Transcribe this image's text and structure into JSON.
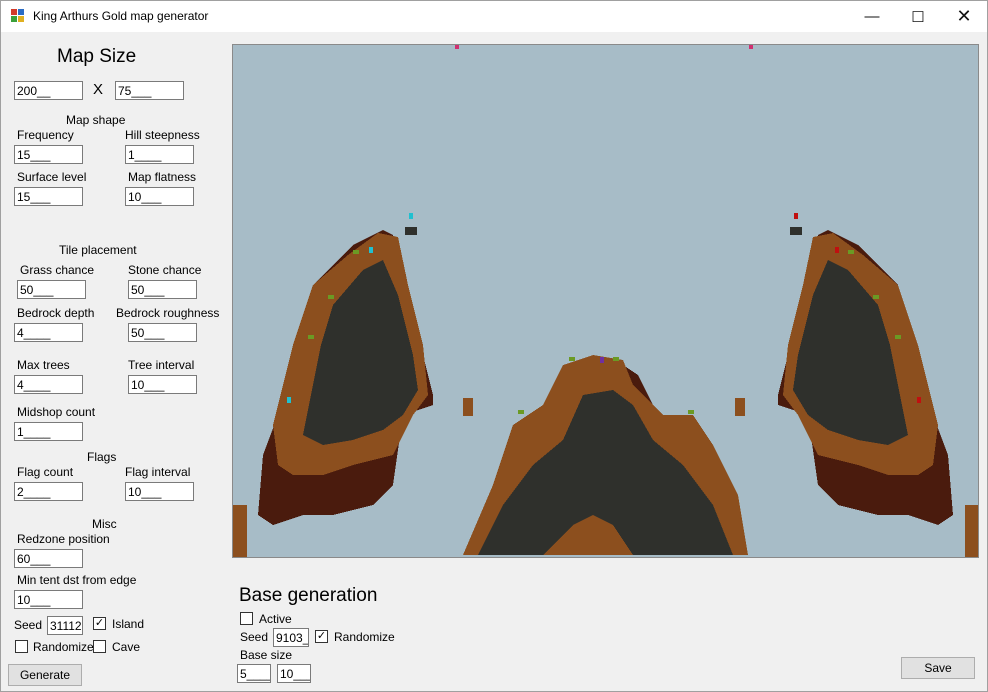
{
  "window": {
    "title": "King Arthurs Gold map generator",
    "minimize_icon": "minimize-icon",
    "maximize_icon": "maximize-icon",
    "close_icon": "close-icon"
  },
  "map_size": {
    "heading": "Map Size",
    "width": "200__",
    "x_label": "X",
    "height": "75___"
  },
  "map_shape": {
    "heading": "Map shape",
    "frequency": {
      "label": "Frequency",
      "value": "15___"
    },
    "hill_steepness": {
      "label": "Hill steepness",
      "value": "1____"
    },
    "surface_level": {
      "label": "Surface level",
      "value": "15___"
    },
    "map_flatness": {
      "label": "Map flatness",
      "value": "10___"
    }
  },
  "tile_placement": {
    "heading": "Tile placement",
    "grass_chance": {
      "label": "Grass chance",
      "value": "50___"
    },
    "stone_chance": {
      "label": "Stone chance",
      "value": "50___"
    },
    "bedrock_depth": {
      "label": "Bedrock depth",
      "value": "4____"
    },
    "bedrock_roughness": {
      "label": "Bedrock roughness",
      "value": "50___"
    },
    "max_trees": {
      "label": "Max trees",
      "value": "4____"
    },
    "tree_interval": {
      "label": "Tree interval",
      "value": "10___"
    },
    "midshop_count": {
      "label": "Midshop count",
      "value": "1____"
    }
  },
  "flags": {
    "heading": "Flags",
    "flag_count": {
      "label": "Flag count",
      "value": "2____"
    },
    "flag_interval": {
      "label": "Flag interval",
      "value": "10___"
    }
  },
  "misc": {
    "heading": "Misc",
    "redzone_position": {
      "label": "Redzone position",
      "value": "60___"
    },
    "min_tent_dst": {
      "label": "Min tent dst from edge",
      "value": "10___"
    },
    "seed_label": "Seed",
    "seed_value": "31112",
    "island_label": "Island",
    "island_checked": true,
    "randomize_label": "Randomize",
    "randomize_checked": false,
    "cave_label": "Cave",
    "cave_checked": false,
    "generate_label": "Generate"
  },
  "base_generation": {
    "heading": "Base generation",
    "active_label": "Active",
    "active_checked": false,
    "seed_label": "Seed",
    "seed_value": "9103_",
    "randomize_label": "Randomize",
    "randomize_checked": true,
    "base_size_label": "Base size",
    "base_size_a": "5____",
    "base_size_b": "10___",
    "save_label": "Save"
  },
  "map_preview": {
    "colors": {
      "sky": "#a7bcc7",
      "dirt": "#8c4f1e",
      "bedrock": "#4a1b0d",
      "stone": "#2f302c",
      "grass": "#6b9a24",
      "gravel": "#5a5a5a",
      "red_flag": "#c01010",
      "blue_tent": "#20c0d0",
      "midshop": "#7030a0",
      "pink": "#d03070"
    }
  }
}
